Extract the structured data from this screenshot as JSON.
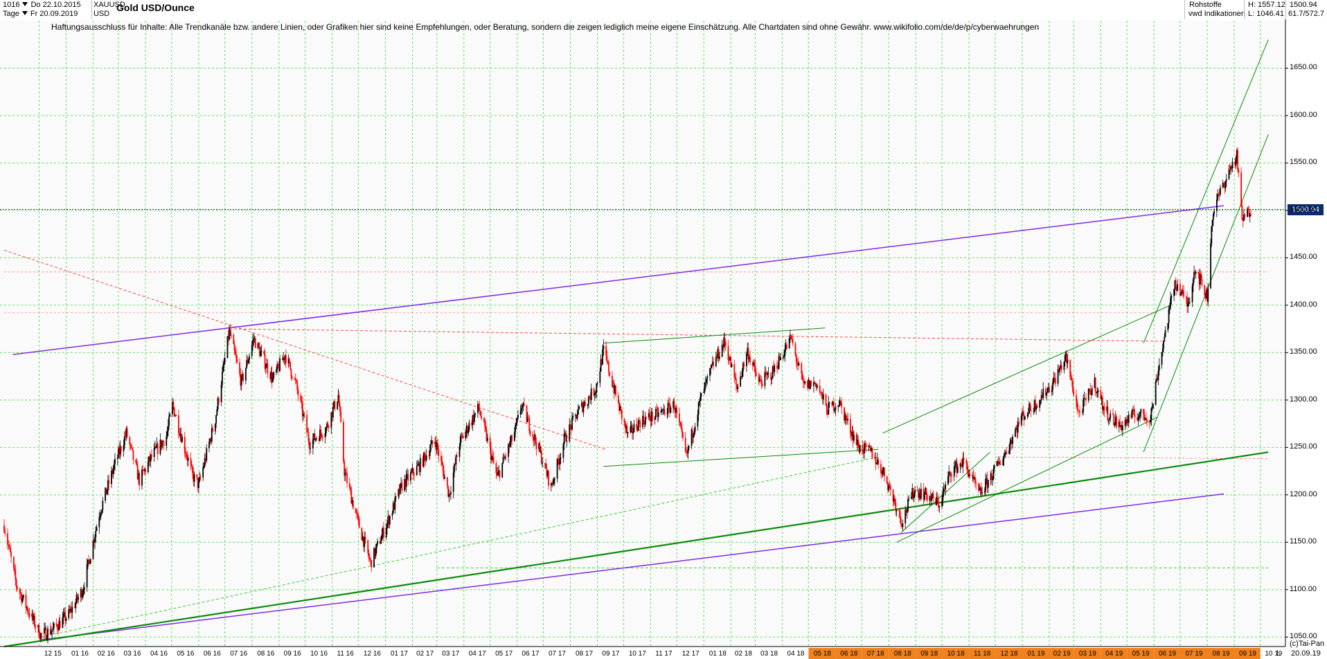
{
  "header": {
    "period_code": "1016",
    "date_from": "Do 22.10.2015",
    "timeframe": "Tage",
    "date_to": "Fr 20.09.2019",
    "symbol": "XAUUSD",
    "currency": "USD",
    "title": "Gold USD/Ounce",
    "category": "Rohstoffe",
    "source": "vwd Indikationen",
    "high_label": "H: 1557.12",
    "low_label": "L: 1046.41",
    "last_value": "1500.94",
    "range_label": "61.7/572.7"
  },
  "disclaimer": "Haftungsausschluss für Inhalte: Alle Trendkanäle bzw. andere Linien, oder Grafiken hier sind keine Empfehlungen, oder Beratung, sondern die zeigen lediglich meine eigene Einschätzung. Alle Chartdaten sind ohne Gewähr.  www.wikifolio.com/de/de/p/cyberwaehrungen",
  "footer": {
    "copyright": "(c)Tai-Pan",
    "scale_mode": "L",
    "date": "20.09.19"
  },
  "colors": {
    "up_candle": "#000000",
    "down_candle": "#ff0000",
    "grid": "#66dd66",
    "purple_line": "#7f28e8",
    "green_line": "#0a8a0a",
    "red_dashed": "#ff4444",
    "price_line": "#0b2a6f",
    "highlight_axis": "#f0821e"
  },
  "chart_data": {
    "type": "candlestick",
    "title": "Gold USD/Ounce",
    "ylim": [
      1040,
      1700
    ],
    "yticks": [
      1050,
      1100,
      1150,
      1200,
      1250,
      1300,
      1350,
      1400,
      1450,
      1500,
      1550,
      1600,
      1650
    ],
    "xtick_labels": [
      "12 15",
      "01 16",
      "02 16",
      "03 16",
      "04 16",
      "05 16",
      "06 16",
      "07 16",
      "08 16",
      "09 16",
      "10 16",
      "11 16",
      "12 16",
      "01 17",
      "02 17",
      "03 17",
      "04 17",
      "05 17",
      "06 17",
      "07 17",
      "08 17",
      "09 17",
      "10 17",
      "11 17",
      "12 17",
      "01 18",
      "02 18",
      "03 18",
      "04 18",
      "05 18",
      "06 18",
      "07 18",
      "08 18",
      "09 18",
      "10 18",
      "11 18",
      "12 18",
      "01 19",
      "02 19",
      "03 19",
      "04 19",
      "05 19",
      "06 19",
      "07 19",
      "08 19",
      "09 19",
      "10 19"
    ],
    "highlighted_xticks": [
      "05 18",
      "06 18",
      "07 18",
      "08 18",
      "09 18",
      "10 18",
      "11 18",
      "12 18",
      "01 19",
      "02 19",
      "03 19",
      "04 19",
      "05 19",
      "06 19",
      "07 19",
      "08 19",
      "09 19"
    ],
    "last_price": 1500.94,
    "high": 1557.12,
    "low": 1046.41,
    "price_path": [
      [
        "2015-10-22",
        1168
      ],
      [
        "2015-11-05",
        1105
      ],
      [
        "2015-11-20",
        1075
      ],
      [
        "2015-12-03",
        1052
      ],
      [
        "2015-12-17",
        1058
      ],
      [
        "2016-01-05",
        1075
      ],
      [
        "2016-01-20",
        1100
      ],
      [
        "2016-02-08",
        1180
      ],
      [
        "2016-02-25",
        1230
      ],
      [
        "2016-03-10",
        1265
      ],
      [
        "2016-03-25",
        1215
      ],
      [
        "2016-04-08",
        1240
      ],
      [
        "2016-04-25",
        1262
      ],
      [
        "2016-05-02",
        1295
      ],
      [
        "2016-05-25",
        1220
      ],
      [
        "2016-06-01",
        1210
      ],
      [
        "2016-06-20",
        1280
      ],
      [
        "2016-07-06",
        1372
      ],
      [
        "2016-07-20",
        1318
      ],
      [
        "2016-08-03",
        1365
      ],
      [
        "2016-08-25",
        1322
      ],
      [
        "2016-09-08",
        1348
      ],
      [
        "2016-09-20",
        1318
      ],
      [
        "2016-10-06",
        1255
      ],
      [
        "2016-10-25",
        1270
      ],
      [
        "2016-11-08",
        1305
      ],
      [
        "2016-11-15",
        1225
      ],
      [
        "2016-12-01",
        1170
      ],
      [
        "2016-12-15",
        1128
      ],
      [
        "2017-01-05",
        1175
      ],
      [
        "2017-01-20",
        1210
      ],
      [
        "2017-02-10",
        1232
      ],
      [
        "2017-02-27",
        1258
      ],
      [
        "2017-03-15",
        1200
      ],
      [
        "2017-03-27",
        1255
      ],
      [
        "2017-04-18",
        1292
      ],
      [
        "2017-05-09",
        1218
      ],
      [
        "2017-05-30",
        1268
      ],
      [
        "2017-06-06",
        1295
      ],
      [
        "2017-06-27",
        1245
      ],
      [
        "2017-07-10",
        1208
      ],
      [
        "2017-07-25",
        1258
      ],
      [
        "2017-08-10",
        1288
      ],
      [
        "2017-08-30",
        1312
      ],
      [
        "2017-09-08",
        1352
      ],
      [
        "2017-09-25",
        1295
      ],
      [
        "2017-10-06",
        1262
      ],
      [
        "2017-10-20",
        1278
      ],
      [
        "2017-11-10",
        1285
      ],
      [
        "2017-11-28",
        1295
      ],
      [
        "2017-12-12",
        1240
      ],
      [
        "2017-12-28",
        1300
      ],
      [
        "2018-01-12",
        1338
      ],
      [
        "2018-01-25",
        1362
      ],
      [
        "2018-02-08",
        1312
      ],
      [
        "2018-02-20",
        1352
      ],
      [
        "2018-03-05",
        1318
      ],
      [
        "2018-03-20",
        1328
      ],
      [
        "2018-04-11",
        1365
      ],
      [
        "2018-04-25",
        1315
      ],
      [
        "2018-05-10",
        1318
      ],
      [
        "2018-05-22",
        1290
      ],
      [
        "2018-06-05",
        1298
      ],
      [
        "2018-06-15",
        1275
      ],
      [
        "2018-06-28",
        1250
      ],
      [
        "2018-07-12",
        1245
      ],
      [
        "2018-07-27",
        1222
      ],
      [
        "2018-08-16",
        1172
      ],
      [
        "2018-08-30",
        1205
      ],
      [
        "2018-09-13",
        1200
      ],
      [
        "2018-09-28",
        1190
      ],
      [
        "2018-10-11",
        1225
      ],
      [
        "2018-10-26",
        1235
      ],
      [
        "2018-11-13",
        1200
      ],
      [
        "2018-11-28",
        1222
      ],
      [
        "2018-12-13",
        1245
      ],
      [
        "2018-12-31",
        1282
      ],
      [
        "2019-01-15",
        1295
      ],
      [
        "2019-02-05",
        1318
      ],
      [
        "2019-02-20",
        1345
      ],
      [
        "2019-03-07",
        1285
      ],
      [
        "2019-03-25",
        1318
      ],
      [
        "2019-04-05",
        1290
      ],
      [
        "2019-04-23",
        1272
      ],
      [
        "2019-05-10",
        1285
      ],
      [
        "2019-05-28",
        1282
      ],
      [
        "2019-06-07",
        1338
      ],
      [
        "2019-06-25",
        1425
      ],
      [
        "2019-07-10",
        1400
      ],
      [
        "2019-07-18",
        1440
      ],
      [
        "2019-08-01",
        1408
      ],
      [
        "2019-08-07",
        1495
      ],
      [
        "2019-08-14",
        1515
      ],
      [
        "2019-08-28",
        1545
      ],
      [
        "2019-09-04",
        1557
      ],
      [
        "2019-09-10",
        1490
      ],
      [
        "2019-09-20",
        1500.94
      ]
    ]
  }
}
